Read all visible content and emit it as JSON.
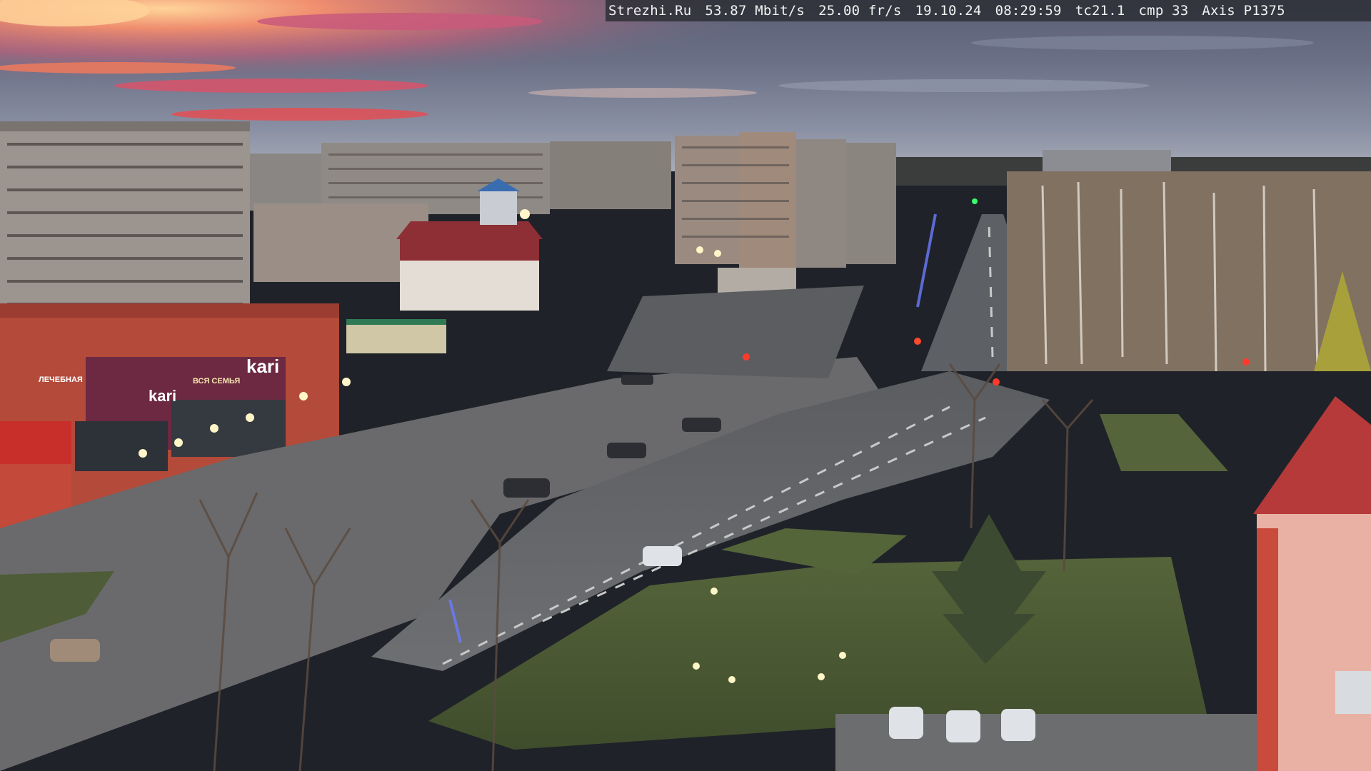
{
  "overlay": {
    "site": "Strezhi.Ru",
    "bitrate": "53.87 Mbit/s",
    "framerate": "25.00 fr/s",
    "date": "19.10.24",
    "time": "08:29:59",
    "tc": "tc21.1",
    "cmp": "cmp 33",
    "camera": "Axis P1375"
  },
  "signs": {
    "store_logo": "kari",
    "store_logo_lower": "kari",
    "shop_sign_left": "ЛЕЧЕБНАЯ",
    "shop_sign_mid": "ВСЯ СЕМЬЯ"
  },
  "colors": {
    "sky_top": "#46546a",
    "sunset": "#e2504a",
    "road": "#65676b",
    "grass": "#4a5a34",
    "brick": "#b34a3a"
  }
}
